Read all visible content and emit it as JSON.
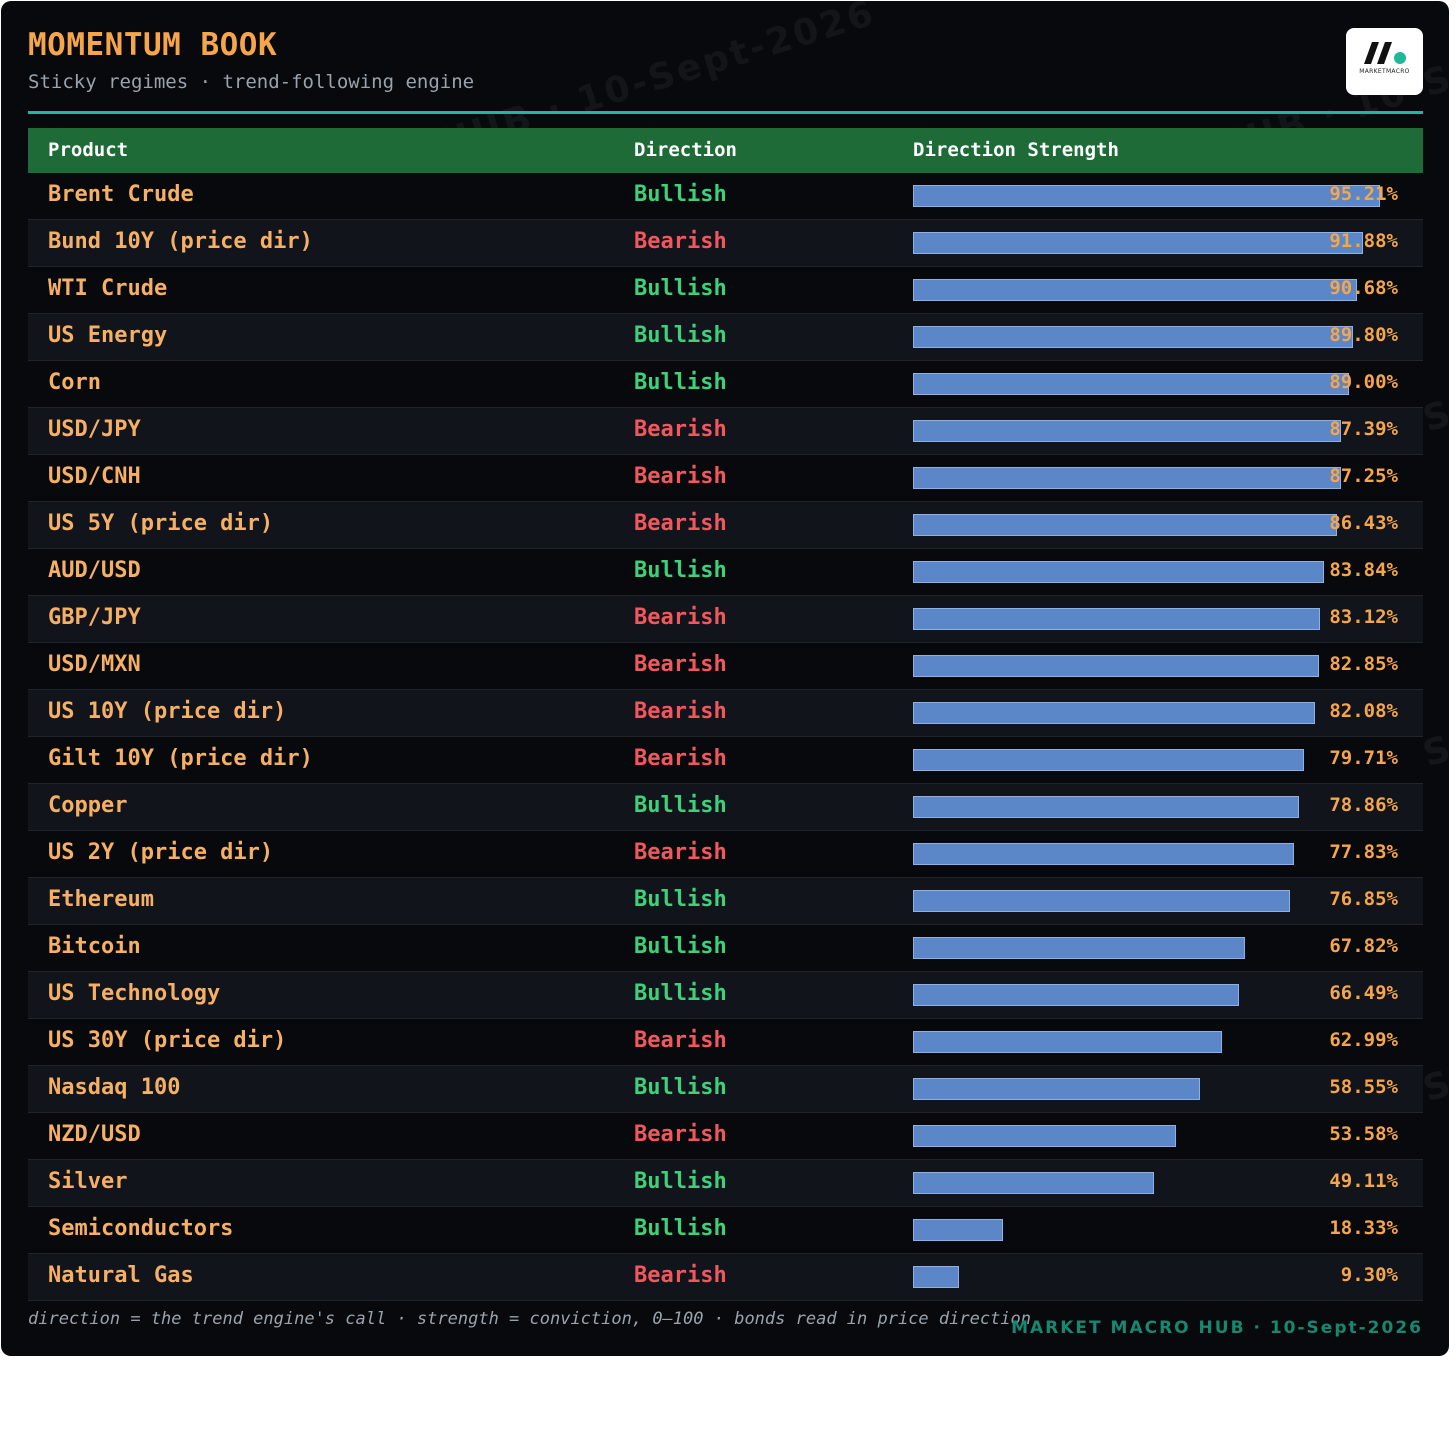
{
  "header": {
    "title": "MOMENTUM BOOK",
    "subtitle": "Sticky regimes · trend-following engine",
    "logo_text": "MARKETMACRO"
  },
  "watermark": {
    "text": "MARKET MACRO HUB · 10-Sept-2026"
  },
  "colors": {
    "title": "#f5a54a",
    "accent_line": "#1fb89a",
    "header_bg": "#1f6b38",
    "bullish": "#3ed07a",
    "bearish": "#f0585d",
    "bar": "#5b86c7",
    "percent": "#f5a54a",
    "brand": "#17876f",
    "background": "#07090d"
  },
  "chart_data": {
    "type": "table",
    "title": "MOMENTUM BOOK",
    "subtitle": "Sticky regimes · trend-following engine",
    "columns": [
      "Product",
      "Direction",
      "Direction Strength"
    ],
    "value_range": [
      0,
      100
    ],
    "rows": [
      {
        "product": "Brent Crude",
        "direction": "Bullish",
        "strength": 95.21,
        "label": "95.21%"
      },
      {
        "product": "Bund 10Y (price dir)",
        "direction": "Bearish",
        "strength": 91.88,
        "label": "91.88%"
      },
      {
        "product": "WTI Crude",
        "direction": "Bullish",
        "strength": 90.68,
        "label": "90.68%"
      },
      {
        "product": "US Energy",
        "direction": "Bullish",
        "strength": 89.8,
        "label": "89.80%"
      },
      {
        "product": "Corn",
        "direction": "Bullish",
        "strength": 89.0,
        "label": "89.00%"
      },
      {
        "product": "USD/JPY",
        "direction": "Bearish",
        "strength": 87.39,
        "label": "87.39%"
      },
      {
        "product": "USD/CNH",
        "direction": "Bearish",
        "strength": 87.25,
        "label": "87.25%"
      },
      {
        "product": "US 5Y (price dir)",
        "direction": "Bearish",
        "strength": 86.43,
        "label": "86.43%"
      },
      {
        "product": "AUD/USD",
        "direction": "Bullish",
        "strength": 83.84,
        "label": "83.84%"
      },
      {
        "product": "GBP/JPY",
        "direction": "Bearish",
        "strength": 83.12,
        "label": "83.12%"
      },
      {
        "product": "USD/MXN",
        "direction": "Bearish",
        "strength": 82.85,
        "label": "82.85%"
      },
      {
        "product": "US 10Y (price dir)",
        "direction": "Bearish",
        "strength": 82.08,
        "label": "82.08%"
      },
      {
        "product": "Gilt 10Y (price dir)",
        "direction": "Bearish",
        "strength": 79.71,
        "label": "79.71%"
      },
      {
        "product": "Copper",
        "direction": "Bullish",
        "strength": 78.86,
        "label": "78.86%"
      },
      {
        "product": "US 2Y (price dir)",
        "direction": "Bearish",
        "strength": 77.83,
        "label": "77.83%"
      },
      {
        "product": "Ethereum",
        "direction": "Bullish",
        "strength": 76.85,
        "label": "76.85%"
      },
      {
        "product": "Bitcoin",
        "direction": "Bullish",
        "strength": 67.82,
        "label": "67.82%"
      },
      {
        "product": "US Technology",
        "direction": "Bullish",
        "strength": 66.49,
        "label": "66.49%"
      },
      {
        "product": "US 30Y (price dir)",
        "direction": "Bearish",
        "strength": 62.99,
        "label": "62.99%"
      },
      {
        "product": "Nasdaq 100",
        "direction": "Bullish",
        "strength": 58.55,
        "label": "58.55%"
      },
      {
        "product": "NZD/USD",
        "direction": "Bearish",
        "strength": 53.58,
        "label": "53.58%"
      },
      {
        "product": "Silver",
        "direction": "Bullish",
        "strength": 49.11,
        "label": "49.11%"
      },
      {
        "product": "Semiconductors",
        "direction": "Bullish",
        "strength": 18.33,
        "label": "18.33%"
      },
      {
        "product": "Natural Gas",
        "direction": "Bearish",
        "strength": 9.3,
        "label": "9.30%"
      }
    ]
  },
  "footer": {
    "note": "direction = the trend engine's call · strength = conviction, 0–100 · bonds read in price direction",
    "brand": "MARKET MACRO HUB · 10-Sept-2026"
  }
}
